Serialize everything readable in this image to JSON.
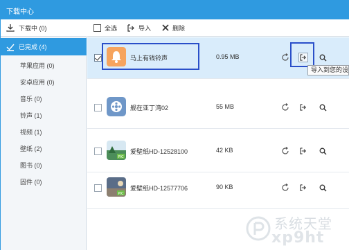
{
  "window": {
    "title": "下载中心"
  },
  "sidebar": {
    "downloading": {
      "label": "下载中 (0)",
      "icon": "download-icon"
    },
    "completed": {
      "label": "已完成 (4)",
      "icon": "checkmark-icon"
    },
    "items": [
      {
        "label": "苹果应用 (0)"
      },
      {
        "label": "安卓应用 (0)"
      },
      {
        "label": "音乐 (0)"
      },
      {
        "label": "铃声 (1)"
      },
      {
        "label": "视频 (1)"
      },
      {
        "label": "壁纸 (2)"
      },
      {
        "label": "图书 (0)"
      },
      {
        "label": "固件 (0)"
      }
    ]
  },
  "toolbar": {
    "select_all": "全选",
    "import": "导入",
    "delete": "删除"
  },
  "files": [
    {
      "name": "马上有钱铃声",
      "size": "0.95 MB",
      "type": "ringtone",
      "checked": true
    },
    {
      "name": "舰在亚丁湾02",
      "size": "55 MB",
      "type": "video",
      "checked": false
    },
    {
      "name": "爱壁纸HD-12528100",
      "size": "42 KB",
      "type": "wallpaper",
      "checked": false
    },
    {
      "name": "爱壁纸HD-12577706",
      "size": "90 KB",
      "type": "wallpaper",
      "checked": false
    }
  ],
  "tooltip": {
    "text": "导入到您的设"
  },
  "watermark": {
    "cn": "系统天堂",
    "en": "xp9ht"
  },
  "colors": {
    "accent": "#2f9ae0",
    "selected_row": "#d9ecfb",
    "highlight_box": "#2a4fc9"
  }
}
